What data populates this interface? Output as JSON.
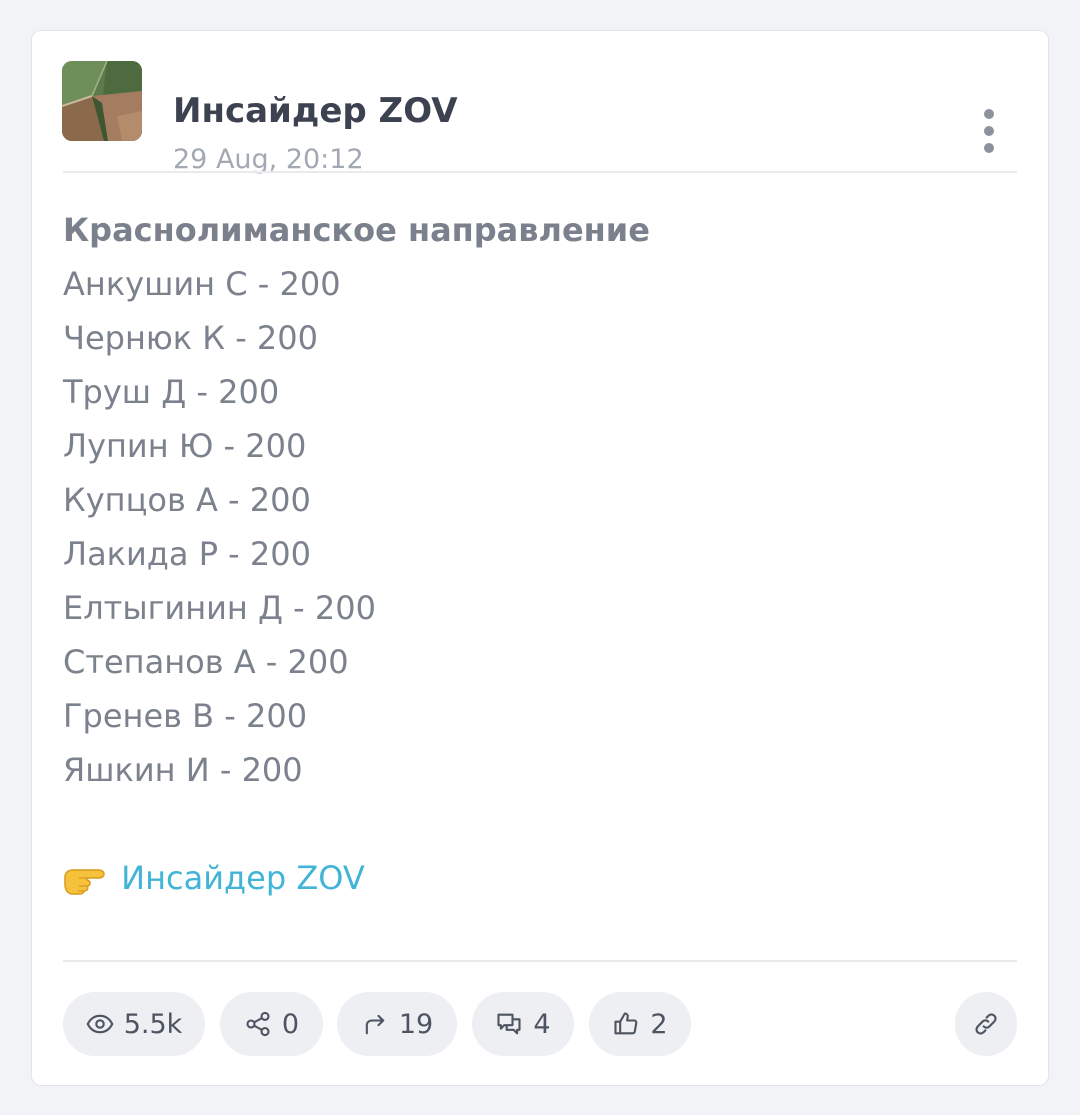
{
  "post": {
    "channel_name": "Инсайдер ZOV",
    "date": "29 Aug, 20:12",
    "heading": "Краснолиманское направление",
    "lines": [
      "Анкушин С - 200",
      "Чернюк К - 200",
      "Труш Д - 200",
      "Лупин Ю - 200",
      "Купцов А - 200",
      "Лакида Р - 200",
      "Елтыгинин Д - 200",
      "Степанов А - 200",
      "Гренев В - 200",
      "Яшкин И - 200"
    ],
    "link_text": "Инсайдер ZOV"
  },
  "stats": {
    "views": "5.5k",
    "shares": "0",
    "forwards": "19",
    "comments": "4",
    "likes": "2"
  },
  "icons": {
    "avatar": "channel-avatar",
    "menu": "more-vertical-icon",
    "hand": "pointing-hand-emoji",
    "views": "eye-icon",
    "shares": "share-nodes-icon",
    "forwards": "forward-arrow-icon",
    "comments": "comments-icon",
    "likes": "thumbs-up-icon",
    "link": "link-icon"
  },
  "colors": {
    "accent_link": "#41b4d7",
    "text": "#7c828d",
    "title": "#3c4250",
    "pill_bg": "#edeff3"
  }
}
